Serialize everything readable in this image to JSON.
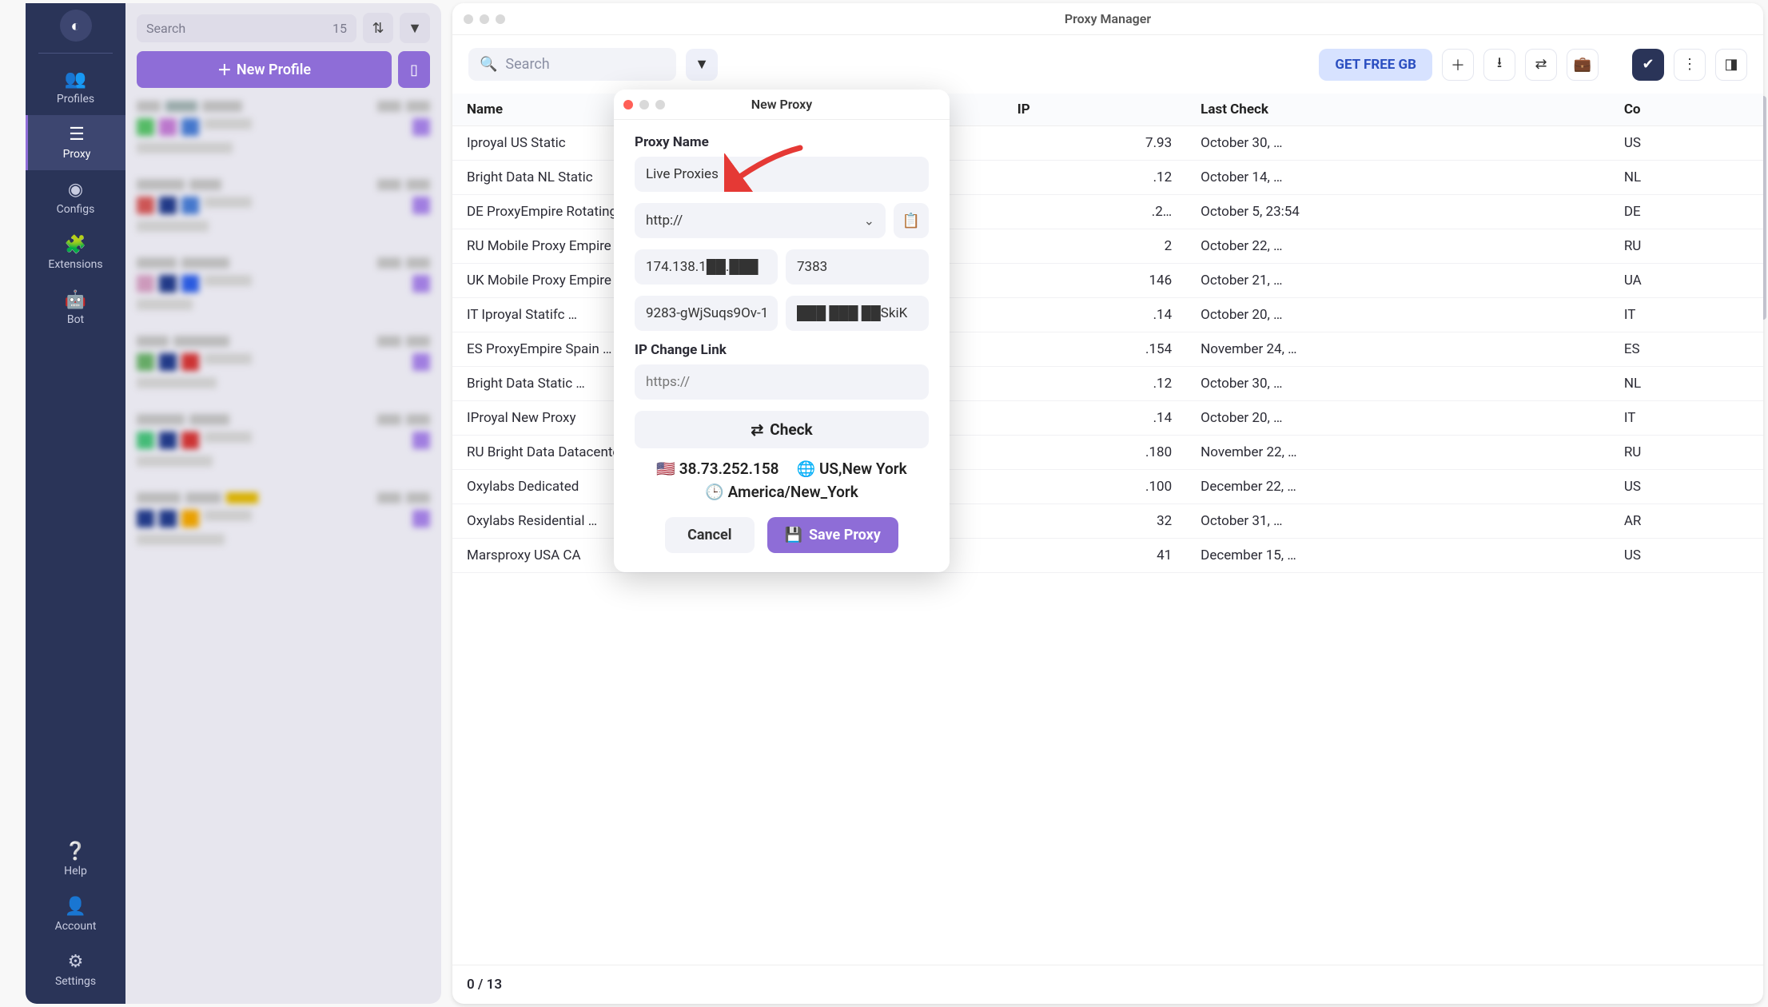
{
  "sidebar": {
    "items": [
      {
        "label": "Profiles"
      },
      {
        "label": "Proxy"
      },
      {
        "label": "Configs"
      },
      {
        "label": "Extensions"
      },
      {
        "label": "Bot"
      }
    ],
    "bottom": [
      {
        "label": "Help"
      },
      {
        "label": "Account"
      },
      {
        "label": "Settings"
      }
    ]
  },
  "profiles": {
    "search_placeholder": "Search",
    "count": "15",
    "new_profile_label": "New Profile"
  },
  "window": {
    "title": "Proxy Manager",
    "search_placeholder": "Search",
    "get_free_label": "GET FREE GB",
    "footer": "0 / 13"
  },
  "table": {
    "headers": [
      "Name",
      "IP",
      "Last Check",
      "Co"
    ],
    "rows": [
      {
        "name": "Iproyal US Static",
        "ip": "7.93",
        "last": "October 30, …",
        "co": "US"
      },
      {
        "name": "Bright Data NL Static",
        "ip": ".12",
        "last": "October 14, …",
        "co": "NL"
      },
      {
        "name": "DE ProxyEmpire Rotating",
        "ip": ".2…",
        "last": "October 5, 23:54",
        "co": "DE"
      },
      {
        "name": "RU Mobile Proxy Empire",
        "ip": "2",
        "last": "October 22, …",
        "co": "RU"
      },
      {
        "name": "UK Mobile Proxy Empire",
        "ip": "146",
        "last": "October 21, …",
        "co": "UA"
      },
      {
        "name": "IT Iproyal Statifc …",
        "ip": ".14",
        "last": "October 20, …",
        "co": "IT"
      },
      {
        "name": "ES ProxyEmpire Spain …",
        "ip": ".154",
        "last": "November 24, …",
        "co": "ES"
      },
      {
        "name": "Bright Data Static …",
        "ip": ".12",
        "last": "October 30, …",
        "co": "NL"
      },
      {
        "name": "IProyal New Proxy",
        "ip": ".14",
        "last": "October 20, …",
        "co": "IT"
      },
      {
        "name": "RU Bright Data Datacenter",
        "ip": ".180",
        "last": "November 22, …",
        "co": "RU"
      },
      {
        "name": "Oxylabs Dedicated",
        "ip": ".100",
        "last": "December 22, …",
        "co": "US"
      },
      {
        "name": "Oxylabs Residential …",
        "ip": "32",
        "last": "October 31, …",
        "co": "AR"
      },
      {
        "name": "Marsproxy USA CA",
        "ip": "41",
        "last": "December 15, …",
        "co": "US"
      }
    ]
  },
  "modal": {
    "title": "New Proxy",
    "name_label": "Proxy Name",
    "name_value": "Live Proxies",
    "protocol": "http://",
    "host": "174.138.1██.███",
    "port": "7383",
    "user": "9283-gWjSuqs9Ov-1",
    "pass": "███ ███ ██SkiK",
    "ipchange_label": "IP Change Link",
    "ipchange_placeholder": "https://",
    "check_label": "Check",
    "check_ip": "38.73.252.158",
    "check_loc": "US,New York",
    "check_tz": "America/New_York",
    "cancel": "Cancel",
    "save": "Save Proxy"
  }
}
